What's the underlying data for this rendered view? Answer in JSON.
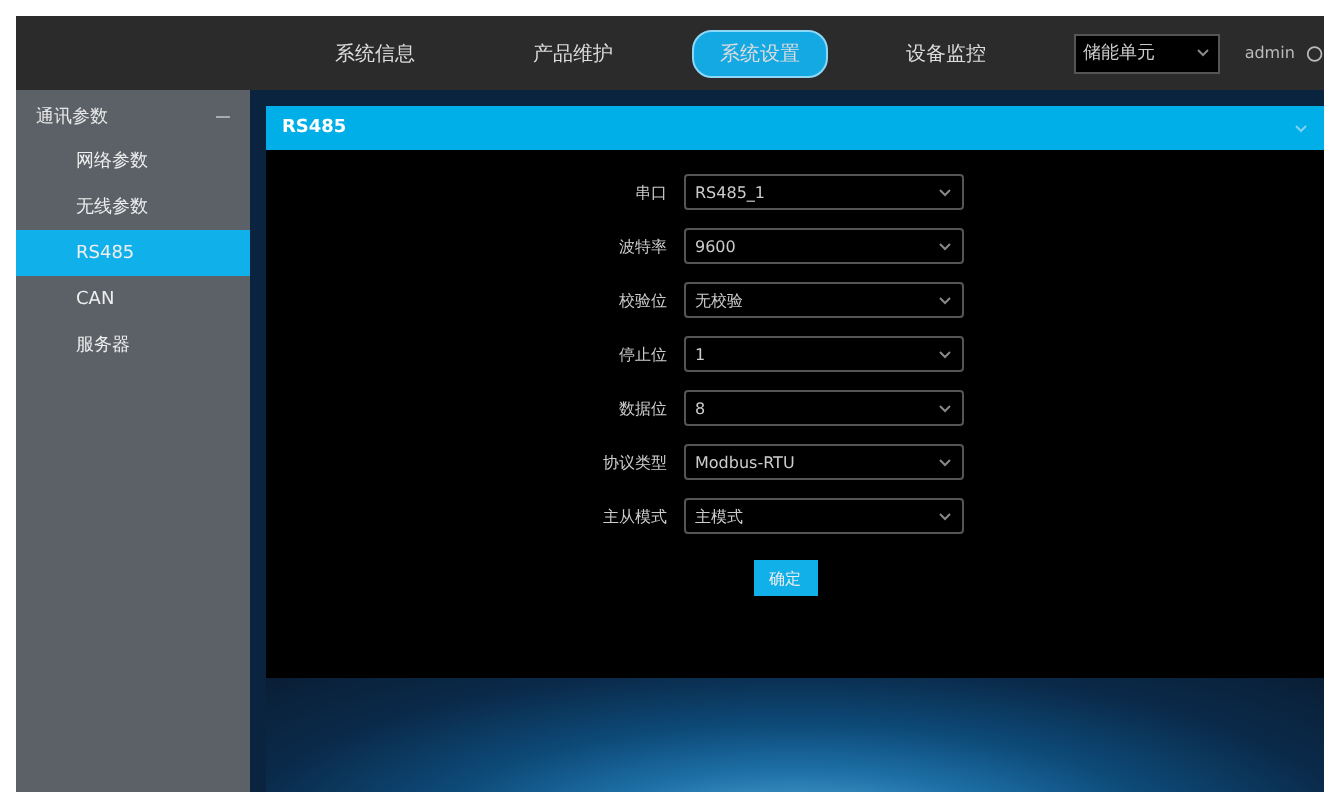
{
  "nav": {
    "tabs": [
      {
        "label": "系统信息",
        "selected": false
      },
      {
        "label": "产品维护",
        "selected": false
      },
      {
        "label": "系统设置",
        "selected": true
      },
      {
        "label": "设备监控",
        "selected": false
      }
    ],
    "unit_select": {
      "value": "储能单元"
    },
    "user": "admin"
  },
  "sidebar": {
    "group": {
      "label": "通讯参数",
      "expanded": true,
      "items": [
        {
          "label": "网络参数",
          "selected": false
        },
        {
          "label": "无线参数",
          "selected": false
        },
        {
          "label": "RS485",
          "selected": true
        },
        {
          "label": "CAN",
          "selected": false
        },
        {
          "label": "服务器",
          "selected": false
        }
      ]
    }
  },
  "panel": {
    "title": "RS485",
    "fields": [
      {
        "label": "串口",
        "value": "RS485_1"
      },
      {
        "label": "波特率",
        "value": "9600"
      },
      {
        "label": "校验位",
        "value": "无校验"
      },
      {
        "label": "停止位",
        "value": "1"
      },
      {
        "label": "数据位",
        "value": "8"
      },
      {
        "label": "协议类型",
        "value": "Modbus-RTU"
      },
      {
        "label": "主从模式",
        "value": "主模式"
      }
    ],
    "submit": "确定"
  }
}
